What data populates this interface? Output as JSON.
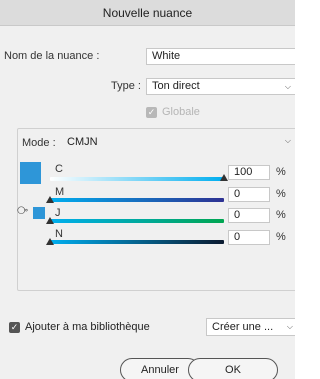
{
  "dialog": {
    "title": "Nouvelle nuance"
  },
  "name_field": {
    "label": "Nom de la nuance :",
    "value": "White"
  },
  "type_field": {
    "label": "Type :",
    "value": "Ton direct"
  },
  "global_option": {
    "label": "Globale",
    "checked": true,
    "enabled": false
  },
  "mode": {
    "label": "Mode :",
    "value": "CMJN"
  },
  "swatch_color": "#2e96d8",
  "channels": [
    {
      "name": "C",
      "value": "100",
      "unit": "%",
      "color_start": "#ffffff",
      "color_end": "#00aeef",
      "level": 1.0
    },
    {
      "name": "M",
      "value": "0",
      "unit": "%",
      "color_start": "#00aeef",
      "color_end": "#2e3192",
      "level": 0.0
    },
    {
      "name": "J",
      "value": "0",
      "unit": "%",
      "color_start": "#00aeef",
      "color_end": "#00a651",
      "level": 0.0
    },
    {
      "name": "N",
      "value": "0",
      "unit": "%",
      "color_start": "#00aeef",
      "color_end": "#0b1a30",
      "level": 0.0
    }
  ],
  "add_to_library": {
    "label": "Ajouter à ma bibliothèque",
    "checked": true
  },
  "library_select": {
    "value": "Créer une ..."
  },
  "buttons": {
    "cancel": "Annuler",
    "ok": "OK"
  }
}
